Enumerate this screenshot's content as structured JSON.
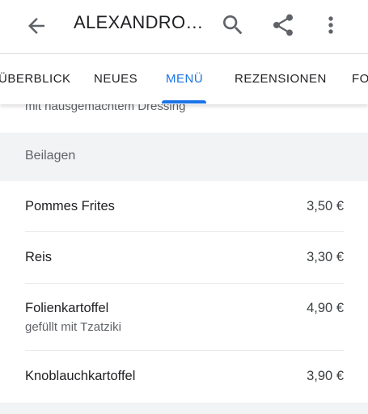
{
  "appbar": {
    "title": "ALEXANDRO…",
    "icons": [
      "back-arrow-icon",
      "search-icon",
      "share-icon",
      "more-vert-icon"
    ]
  },
  "tabs": [
    {
      "label": "ÜBERBLICK"
    },
    {
      "label": "NEUES"
    },
    {
      "label": "MENÜ",
      "active": true
    },
    {
      "label": "REZENSIONEN"
    },
    {
      "label": "FO"
    }
  ],
  "menu": {
    "previous_description": "mit hausgemachtem Dressing",
    "category": "Beilagen",
    "items": [
      {
        "name": "Pommes Frites",
        "price": "3,50 €"
      },
      {
        "name": "Reis",
        "price": "3,30 €"
      },
      {
        "name": "Folienkartoffel",
        "price": "4,90 €",
        "description": "gefüllt mit Tzatziki"
      },
      {
        "name": "Knoblauchkartoffel",
        "price": "3,90 €"
      }
    ]
  },
  "colors": {
    "accent": "#1a73e8",
    "category_bg": "#f1f3f4",
    "secondary_text": "#5f6368"
  }
}
